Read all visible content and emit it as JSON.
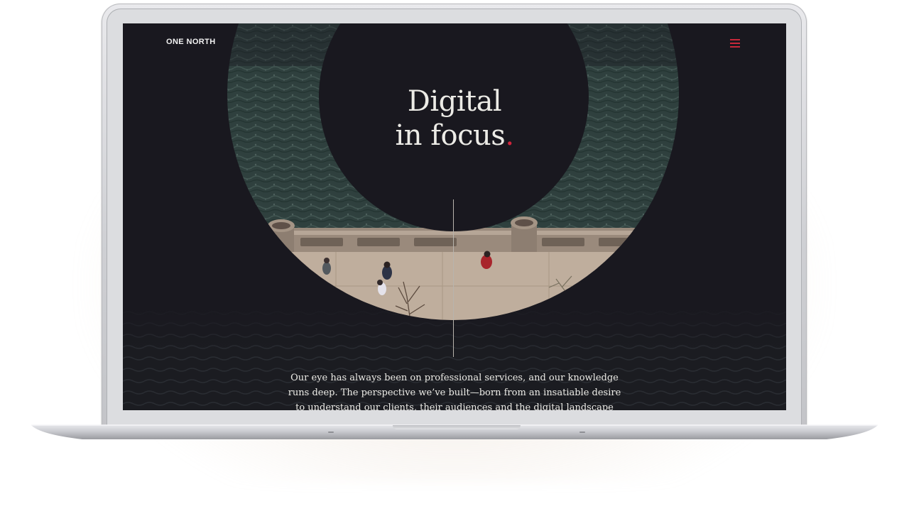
{
  "brand": {
    "logo_text": "ONE NORTH"
  },
  "nav": {
    "menu_icon": "hamburger-menu-icon"
  },
  "hero": {
    "headline_line1": "Digital",
    "headline_line2": "in focus",
    "headline_dot": "."
  },
  "intro": {
    "line1": "Our eye has always been on professional services, and our knowledge",
    "line2": "runs deep. The perspective we’ve built—born from an insatiable desire",
    "line3": "to understand our clients, their audiences and the digital landscape"
  },
  "colors": {
    "screen_background": "#19181f",
    "accent": "#d0243b",
    "text": "#ecebe6",
    "water": "#2e3f3d",
    "sidewalk": "#bfae9d"
  }
}
